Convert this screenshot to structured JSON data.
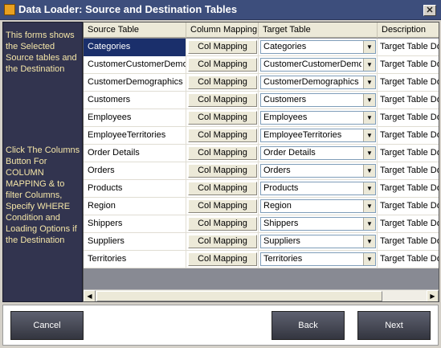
{
  "window": {
    "title": "Data Loader: Source and Destination Tables"
  },
  "info": {
    "top_text": "This forms shows the Selected Source tables and the Destination",
    "bottom_text": "Click The Columns Button For COLUMN MAPPING & to filter Columns, Specify WHERE Condition and Loading Options if the Destination"
  },
  "grid": {
    "headers": {
      "source": "Source Table",
      "mapping": "Column Mapping",
      "target": "Target Table",
      "description": "Description"
    },
    "rows": [
      {
        "source": "Categories",
        "mapping": "Col Mapping",
        "target": "Categories",
        "description": "Target Table Do"
      },
      {
        "source": "CustomerCustomerDemo",
        "mapping": "Col Mapping",
        "target": "CustomerCustomerDemo",
        "description": "Target Table Do"
      },
      {
        "source": "CustomerDemographics",
        "mapping": "Col Mapping",
        "target": "CustomerDemographics",
        "description": "Target Table Do"
      },
      {
        "source": "Customers",
        "mapping": "Col Mapping",
        "target": "Customers",
        "description": "Target Table Do"
      },
      {
        "source": "Employees",
        "mapping": "Col Mapping",
        "target": "Employees",
        "description": "Target Table Do"
      },
      {
        "source": "EmployeeTerritories",
        "mapping": "Col Mapping",
        "target": "EmployeeTerritories",
        "description": "Target Table Do"
      },
      {
        "source": "Order Details",
        "mapping": "Col Mapping",
        "target": "Order Details",
        "description": "Target Table Do"
      },
      {
        "source": "Orders",
        "mapping": "Col Mapping",
        "target": "Orders",
        "description": "Target Table Do"
      },
      {
        "source": "Products",
        "mapping": "Col Mapping",
        "target": "Products",
        "description": "Target Table Do"
      },
      {
        "source": "Region",
        "mapping": "Col Mapping",
        "target": "Region",
        "description": "Target Table Do"
      },
      {
        "source": "Shippers",
        "mapping": "Col Mapping",
        "target": "Shippers",
        "description": "Target Table Do"
      },
      {
        "source": "Suppliers",
        "mapping": "Col Mapping",
        "target": "Suppliers",
        "description": "Target Table Do"
      },
      {
        "source": "Territories",
        "mapping": "Col Mapping",
        "target": "Territories",
        "description": "Target Table Do"
      }
    ]
  },
  "buttons": {
    "cancel": "Cancel",
    "back": "Back",
    "next": "Next"
  },
  "icons": {
    "close": "close-icon",
    "app": "app-icon",
    "dropdown": "chevron-down-icon",
    "scroll_left": "arrow-left-icon",
    "scroll_right": "arrow-right-icon"
  },
  "colors": {
    "titlebar": "#3d4e7c",
    "info_panel": "#32344f",
    "info_text": "#f5e6a8",
    "selection": "#1a2f6b",
    "grid_background": "#888a93"
  }
}
